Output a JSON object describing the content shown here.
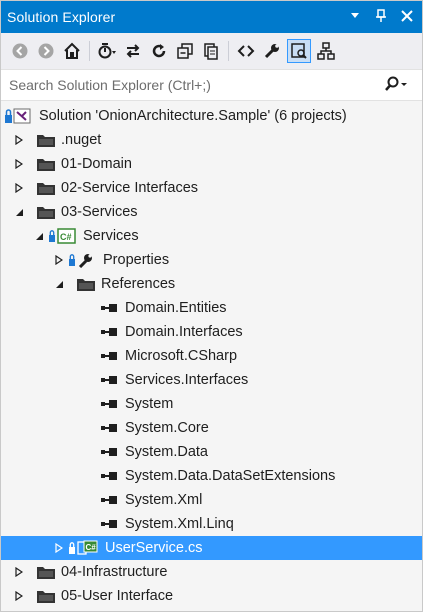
{
  "window": {
    "title": "Solution Explorer"
  },
  "search": {
    "placeholder": "Search Solution Explorer (Ctrl+;)"
  },
  "tree": {
    "solution": "Solution 'OnionArchitecture.Sample' (6 projects)",
    "nuget": ".nuget",
    "domain": "01-Domain",
    "service_interfaces": "02-Service Interfaces",
    "services_folder": "03-Services",
    "services_project": "Services",
    "properties": "Properties",
    "references": "References",
    "refs": [
      "Domain.Entities",
      "Domain.Interfaces",
      "Microsoft.CSharp",
      "Services.Interfaces",
      "System",
      "System.Core",
      "System.Data",
      "System.Data.DataSetExtensions",
      "System.Xml",
      "System.Xml.Linq"
    ],
    "userservice": "UserService.cs",
    "infrastructure": "04-Infrastructure",
    "user_interface": "05-User Interface"
  },
  "colors": {
    "title_bar": "#007acc",
    "selection": "#3399ff"
  }
}
